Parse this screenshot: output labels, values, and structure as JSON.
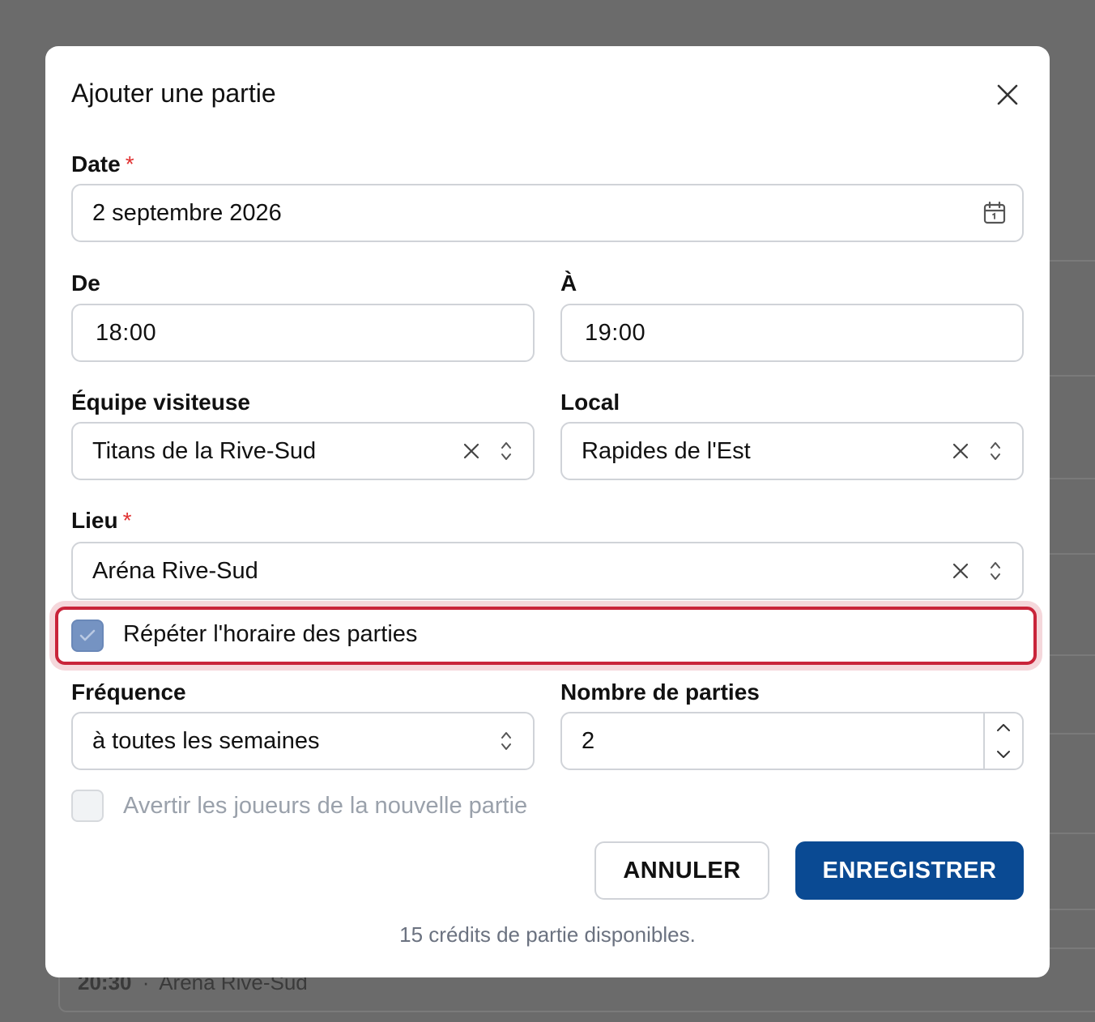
{
  "background": {
    "card_time": "20:30",
    "card_separator": "·",
    "card_venue": "Aréna Rive-Sud"
  },
  "dialog": {
    "title": "Ajouter une partie",
    "close_icon": "close-icon",
    "date": {
      "label": "Date",
      "required_mark": "*",
      "value": "2 septembre 2026",
      "icon": "calendar-icon"
    },
    "from": {
      "label": "De",
      "value": "18:00"
    },
    "to": {
      "label": "À",
      "value": "19:00"
    },
    "visiting_team": {
      "label": "Équipe visiteuse",
      "value": "Titans de la Rive-Sud",
      "clear_icon": "clear-icon",
      "select_icon": "chevron-updown-icon"
    },
    "home_team": {
      "label": "Local",
      "value": "Rapides de l'Est",
      "clear_icon": "clear-icon",
      "select_icon": "chevron-updown-icon"
    },
    "venue": {
      "label": "Lieu",
      "required_mark": "*",
      "value": "Aréna Rive-Sud",
      "clear_icon": "clear-icon",
      "select_icon": "chevron-updown-icon"
    },
    "repeat_schedule": {
      "label": "Répéter l'horaire des parties",
      "checked": true,
      "highlight_color": "#c9243a"
    },
    "frequency": {
      "label": "Fréquence",
      "value": "à toutes les semaines",
      "select_icon": "chevron-updown-icon"
    },
    "game_count": {
      "label": "Nombre de parties",
      "value": "2",
      "increment_icon": "chevron-up-icon",
      "decrement_icon": "chevron-down-icon"
    },
    "notify_players": {
      "label": "Avertir les joueurs de la nouvelle partie",
      "checked": false,
      "disabled": true
    },
    "buttons": {
      "cancel": "ANNULER",
      "save": "ENREGISTRER"
    },
    "credits_text": "15 crédits de partie disponibles."
  },
  "colors": {
    "primary": "#0a4a93",
    "required": "#e03131",
    "checkbox_checked": "#7593c2",
    "muted_text": "#6b7280"
  }
}
